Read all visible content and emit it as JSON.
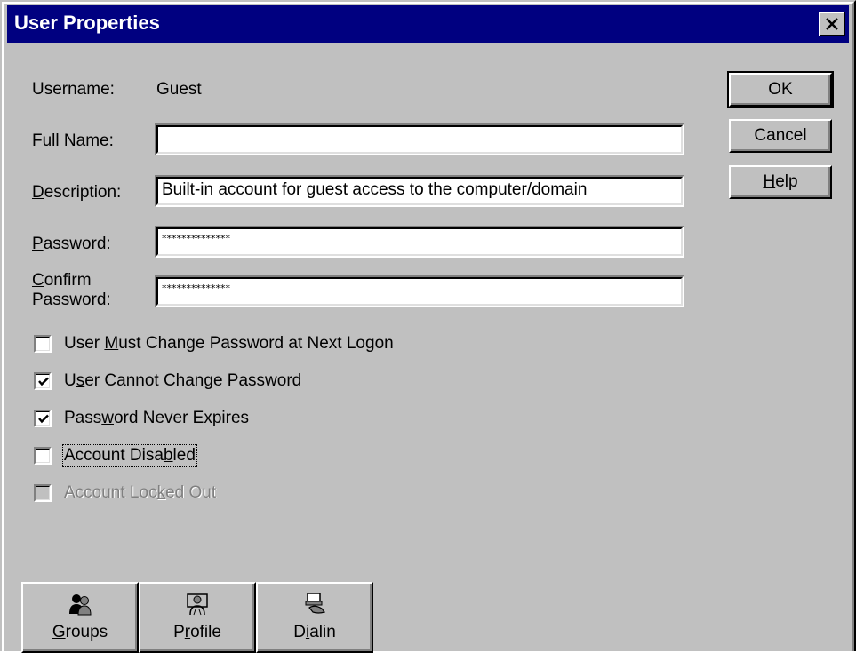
{
  "window": {
    "title": "User Properties",
    "close_icon": "close-icon"
  },
  "fields": {
    "username_label": "Username:",
    "username_value": "Guest",
    "fullname_label_pre": "Full ",
    "fullname_label_u": "N",
    "fullname_label_post": "ame:",
    "fullname_value": "",
    "description_label_u": "D",
    "description_label_post": "escription:",
    "description_value": "Built-in account for guest access to the computer/domain",
    "password_label_u": "P",
    "password_label_post": "assword:",
    "password_value": "**************",
    "confirm_label_u": "C",
    "confirm_label_post": "onfirm",
    "confirm_label_line2": "Password:",
    "confirm_value": "**************"
  },
  "buttons": {
    "ok": "OK",
    "cancel": "Cancel",
    "help_u": "H",
    "help_post": "elp"
  },
  "checkboxes": [
    {
      "pre": "User ",
      "u": "M",
      "post": "ust Change Password at Next Logon",
      "checked": false,
      "disabled": false
    },
    {
      "pre": "U",
      "u": "s",
      "post": "er Cannot Change Password",
      "checked": true,
      "disabled": false
    },
    {
      "pre": "Pass",
      "u": "w",
      "post": "ord Never Expires",
      "checked": true,
      "disabled": false
    },
    {
      "pre": "Account Disa",
      "u": "b",
      "post": "led",
      "checked": false,
      "disabled": false
    },
    {
      "pre": "Account Loc",
      "u": "k",
      "post": "ed Out",
      "checked": false,
      "disabled": true
    }
  ],
  "bottom_buttons": [
    {
      "u": "G",
      "post": "roups",
      "pre": "",
      "icon": "groups-icon"
    },
    {
      "pre": "P",
      "u": "r",
      "post": "ofile",
      "icon": "profile-icon"
    },
    {
      "pre": "D",
      "u": "i",
      "post": "alin",
      "icon": "dialin-icon"
    }
  ]
}
